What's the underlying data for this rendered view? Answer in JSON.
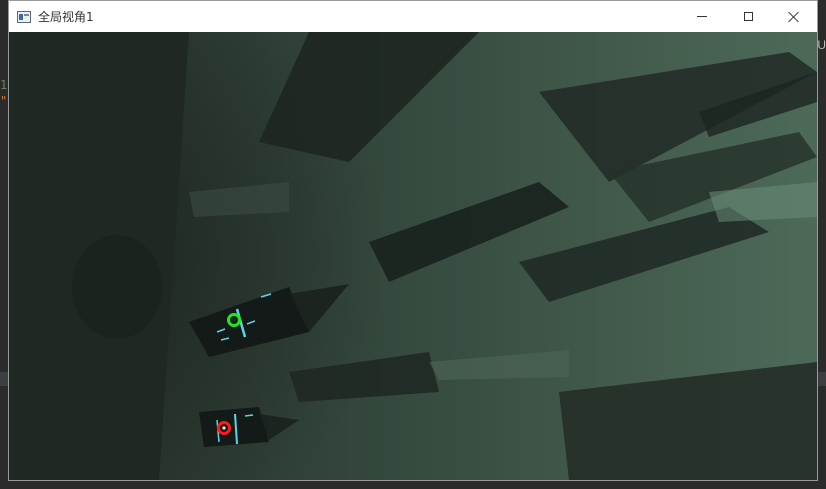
{
  "window": {
    "title": "全局视角1",
    "controls": {
      "minimize_icon": "minimize-icon",
      "maximize_icon": "maximize-icon",
      "close_icon": "close-icon"
    }
  },
  "background_ide": {
    "visible_fragments": [
      "1",
      "\"",
      "U"
    ]
  },
  "camera_view": {
    "markers": [
      {
        "name": "green-marker",
        "color": "#1ee81e"
      },
      {
        "name": "red-marker",
        "color": "#ff1a1a"
      }
    ],
    "scene_colors": {
      "base": "#28322c",
      "wall": "#4a6656",
      "shadow": "#1a211d",
      "light_strip": "#5fd3e6"
    }
  }
}
